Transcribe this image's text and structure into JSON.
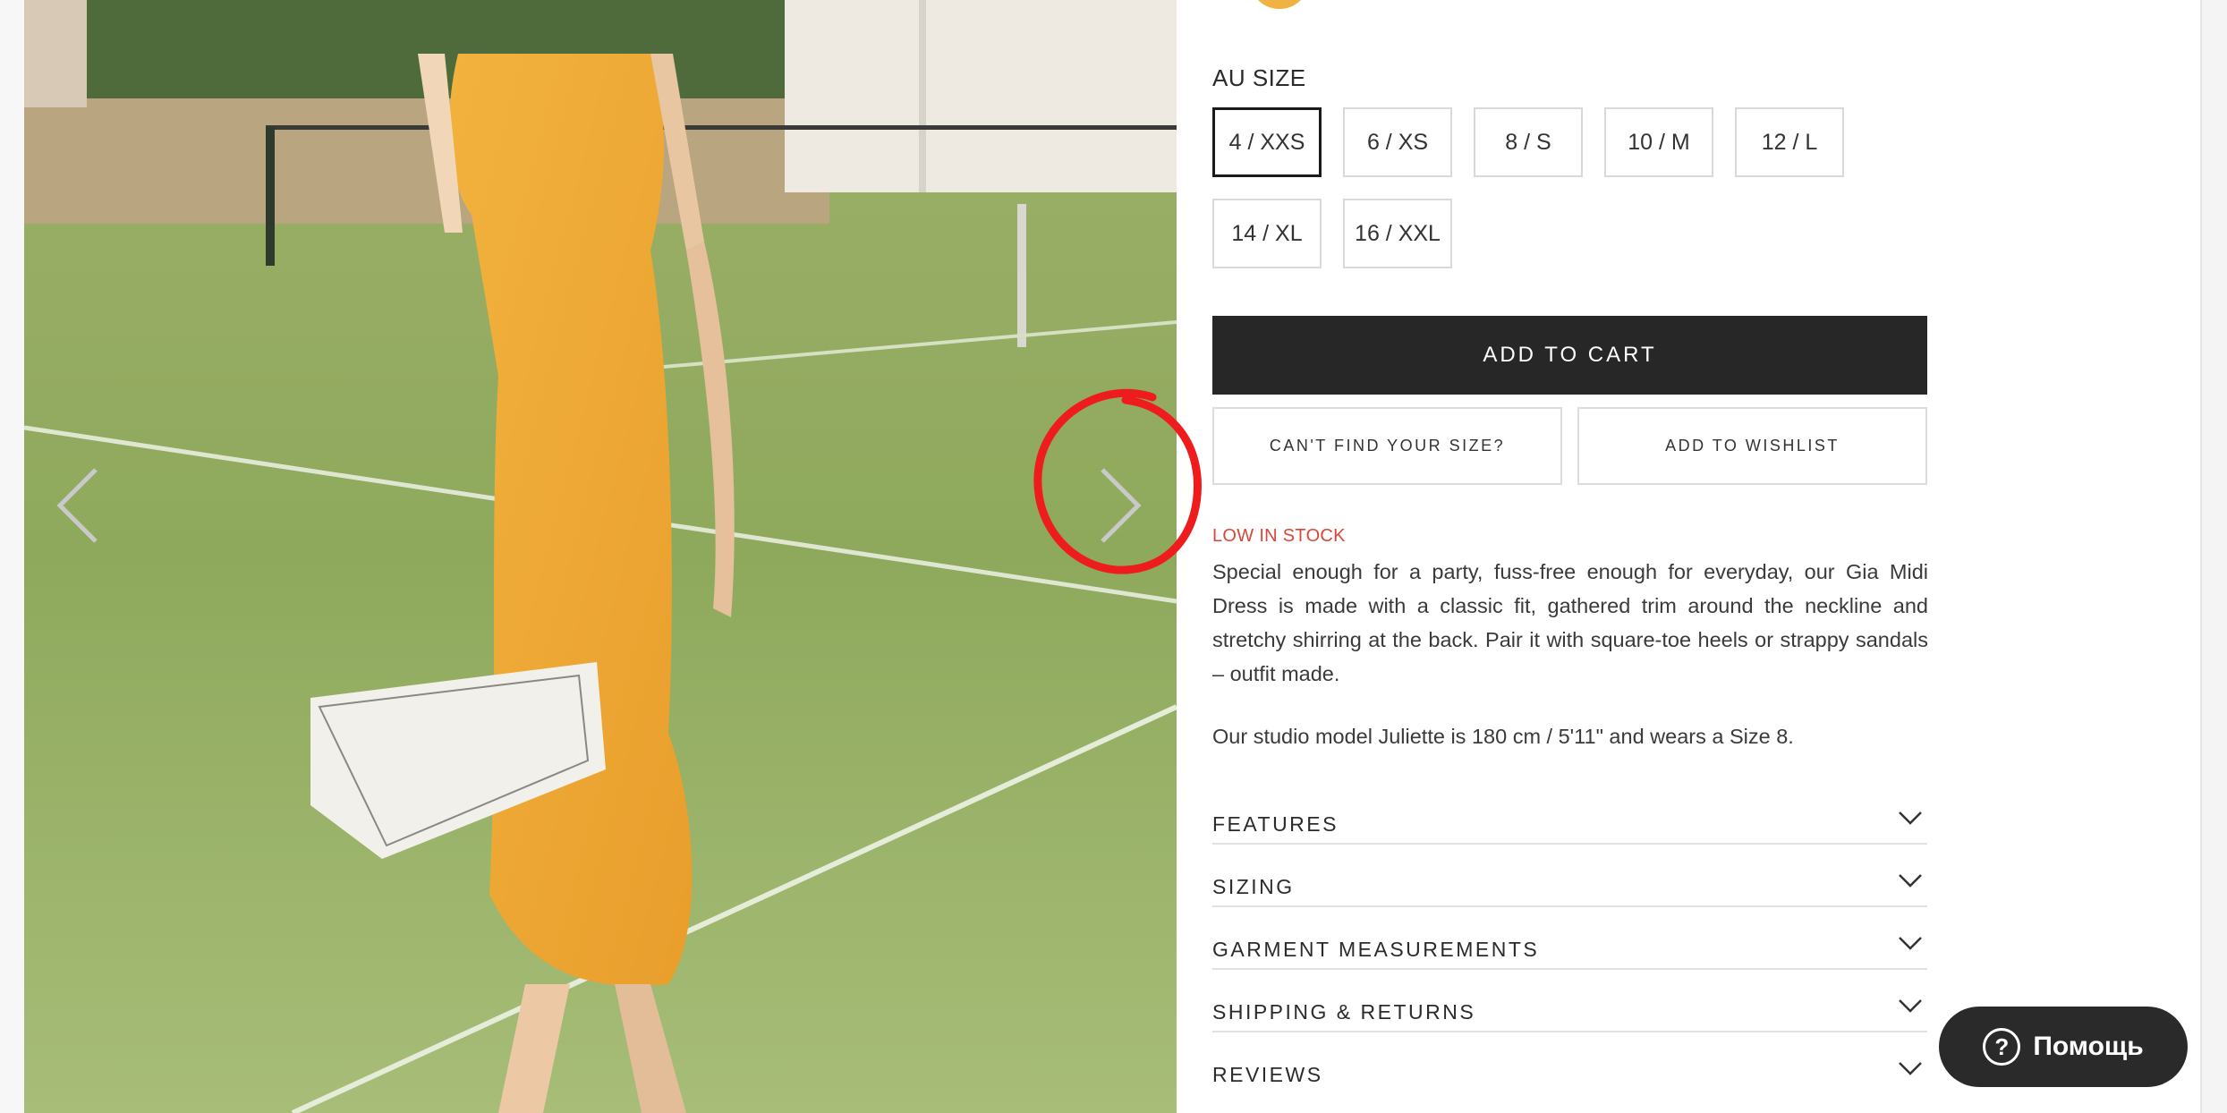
{
  "gallery": {
    "image_alt": "Model in orange floral midi dress on tennis court"
  },
  "size": {
    "label": "AU SIZE",
    "options": [
      "4 / XXS",
      "6 / XS",
      "8 / S",
      "10 / M",
      "12 / L",
      "14 / XL",
      "16 / XXL"
    ],
    "selected": "4 / XXS"
  },
  "actions": {
    "add_to_cart": "ADD TO CART",
    "cant_find_size": "CAN'T FIND YOUR SIZE?",
    "add_to_wishlist": "ADD TO WISHLIST"
  },
  "stock_status": "LOW IN STOCK",
  "description": "Special enough for a party, fuss-free enough for everyday, our Gia Midi Dress is made with a classic fit, gathered trim around the neckline and stretchy shirring at the back. Pair it with square-toe heels or strappy sandals – outfit made.",
  "model_note": "Our studio model Juliette is 180 cm / 5'11\" and wears a Size 8.",
  "accordion": [
    "FEATURES",
    "SIZING",
    "GARMENT MEASUREMENTS",
    "SHIPPING & RETURNS",
    "REVIEWS"
  ],
  "help_button": {
    "label": "Помощь"
  },
  "colors": {
    "stock_red": "#d9463a",
    "button_dark": "#272727",
    "annotation_red": "#ee1c1c"
  }
}
